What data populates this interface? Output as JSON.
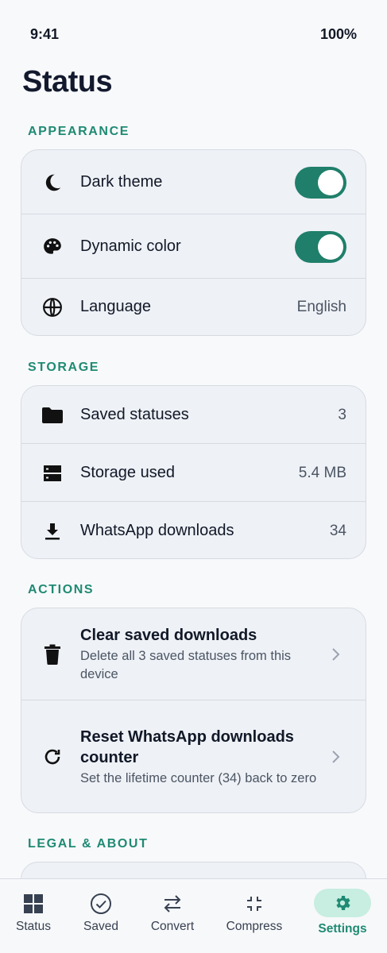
{
  "status_bar": {
    "time": "9:41",
    "battery": "100%"
  },
  "page_title": "Status",
  "sections": {
    "appearance": {
      "header": "APPEARANCE",
      "dark_theme": {
        "label": "Dark theme",
        "enabled": true
      },
      "dynamic_color": {
        "label": "Dynamic color",
        "enabled": true
      },
      "language": {
        "label": "Language",
        "value": "English"
      }
    },
    "storage": {
      "header": "STORAGE",
      "saved_statuses": {
        "label": "Saved statuses",
        "value": "3"
      },
      "storage_used": {
        "label": "Storage used",
        "value": "5.4 MB"
      },
      "whatsapp_downloads": {
        "label": "WhatsApp downloads",
        "value": "34"
      }
    },
    "actions": {
      "header": "ACTIONS",
      "clear": {
        "title": "Clear saved downloads",
        "subtitle": "Delete all 3 saved statuses from this device"
      },
      "reset": {
        "title": "Reset WhatsApp downloads counter",
        "subtitle": "Set the lifetime counter (34) back to zero"
      }
    },
    "legal": {
      "header": "LEGAL & ABOUT"
    }
  },
  "bottom_nav": {
    "items": [
      {
        "label": "Status",
        "icon": "grid-icon"
      },
      {
        "label": "Saved",
        "icon": "check-circle-icon"
      },
      {
        "label": "Convert",
        "icon": "swap-arrows-icon"
      },
      {
        "label": "Compress",
        "icon": "compress-icon"
      },
      {
        "label": "Settings",
        "icon": "gear-icon",
        "active": true
      }
    ]
  },
  "colors": {
    "accent": "#1f8a73",
    "toggle_on": "#1f7f6a",
    "active_pill": "#c7eee0"
  }
}
